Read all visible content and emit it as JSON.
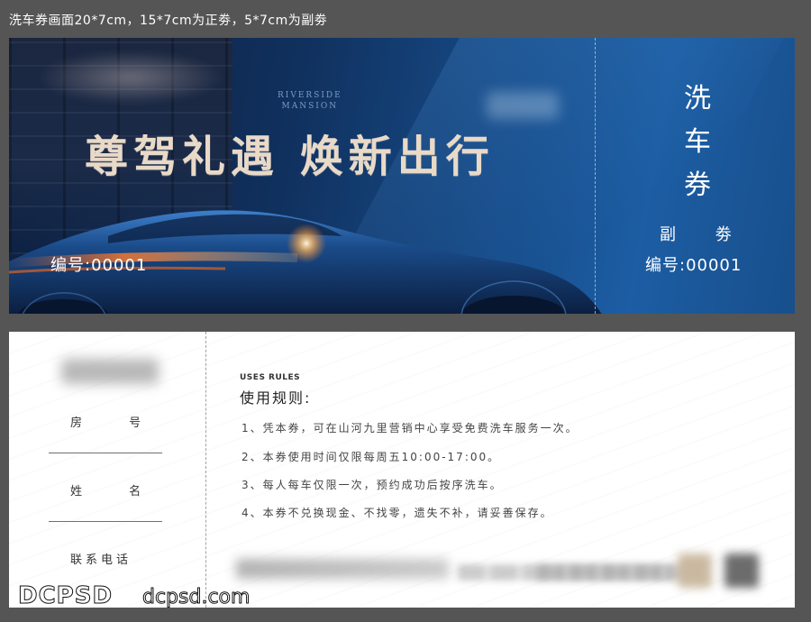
{
  "caption": "洗车券画面20*7cm，15*7cm为正劵，5*7cm为副劵",
  "front": {
    "brand_en_line1": "RIVERSIDE",
    "brand_en_line2": "MANSION",
    "headline": "尊驾礼遇 焕新出行",
    "serial": "编号:00001",
    "stub_title_1": "洗",
    "stub_title_2": "车",
    "stub_title_3": "券",
    "stub_sub": "副 劵",
    "stub_serial": "编号:00001",
    "accent_color": "#e9d9c7",
    "bg_color": "#164a86"
  },
  "back": {
    "field_room": "房 号",
    "field_name": "姓 名",
    "field_phone": "联系电话",
    "rules_en": "USES RULES",
    "rules_zh": "使用规则:",
    "rules": [
      "1、凭本券，可在山河九里营销中心享受免费洗车服务一次。",
      "2、本券使用时间仅限每周五10:00-17:00。",
      "3、每人每车仅限一次，预约成功后按序洗车。",
      "4、本券不兑换现金、不找零，遗失不补，请妥善保存。"
    ]
  },
  "watermark": {
    "left": "DCPSD",
    "right": "dcpsd.com"
  }
}
